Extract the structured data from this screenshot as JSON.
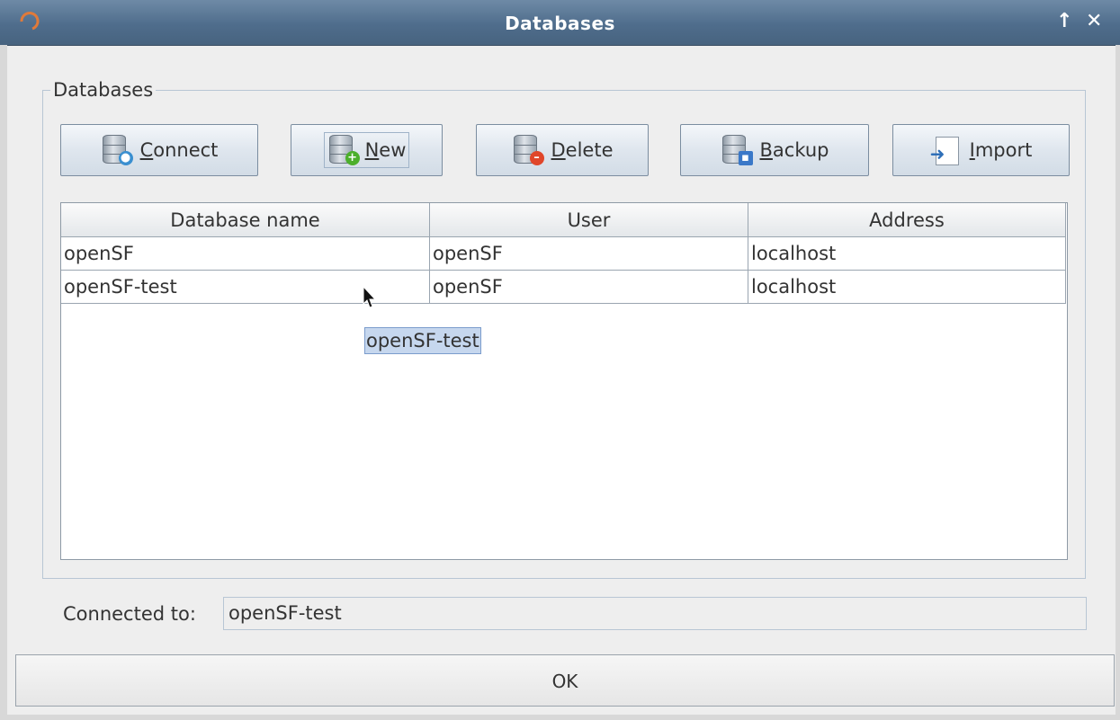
{
  "window": {
    "title": "Databases",
    "maximize_glyph": "↑",
    "close_glyph": "✕"
  },
  "group": {
    "legend": "Databases"
  },
  "toolbar": {
    "connect": {
      "pre": "",
      "mnemonic": "C",
      "post": "onnect",
      "icon": "database-connect-icon"
    },
    "new": {
      "pre": "",
      "mnemonic": "N",
      "post": "ew",
      "icon": "database-add-icon"
    },
    "delete": {
      "pre": "",
      "mnemonic": "D",
      "post": "elete",
      "icon": "database-delete-icon"
    },
    "backup": {
      "pre": "",
      "mnemonic": "B",
      "post": "ackup",
      "icon": "database-backup-icon"
    },
    "import": {
      "pre": "",
      "mnemonic": "I",
      "post": "mport",
      "icon": "import-icon"
    }
  },
  "table": {
    "columns": [
      "Database name",
      "User",
      "Address"
    ],
    "rows": [
      [
        "openSF",
        "openSF",
        "localhost"
      ],
      [
        "openSF-test",
        "openSF",
        "localhost"
      ]
    ]
  },
  "drag_ghost": "openSF-test",
  "status": {
    "label": "Connected to:",
    "value": "openSF-test"
  },
  "ok_label": "OK",
  "colors": {
    "titlebar": "#4f6d8c",
    "selection": "#c6d7ee"
  }
}
